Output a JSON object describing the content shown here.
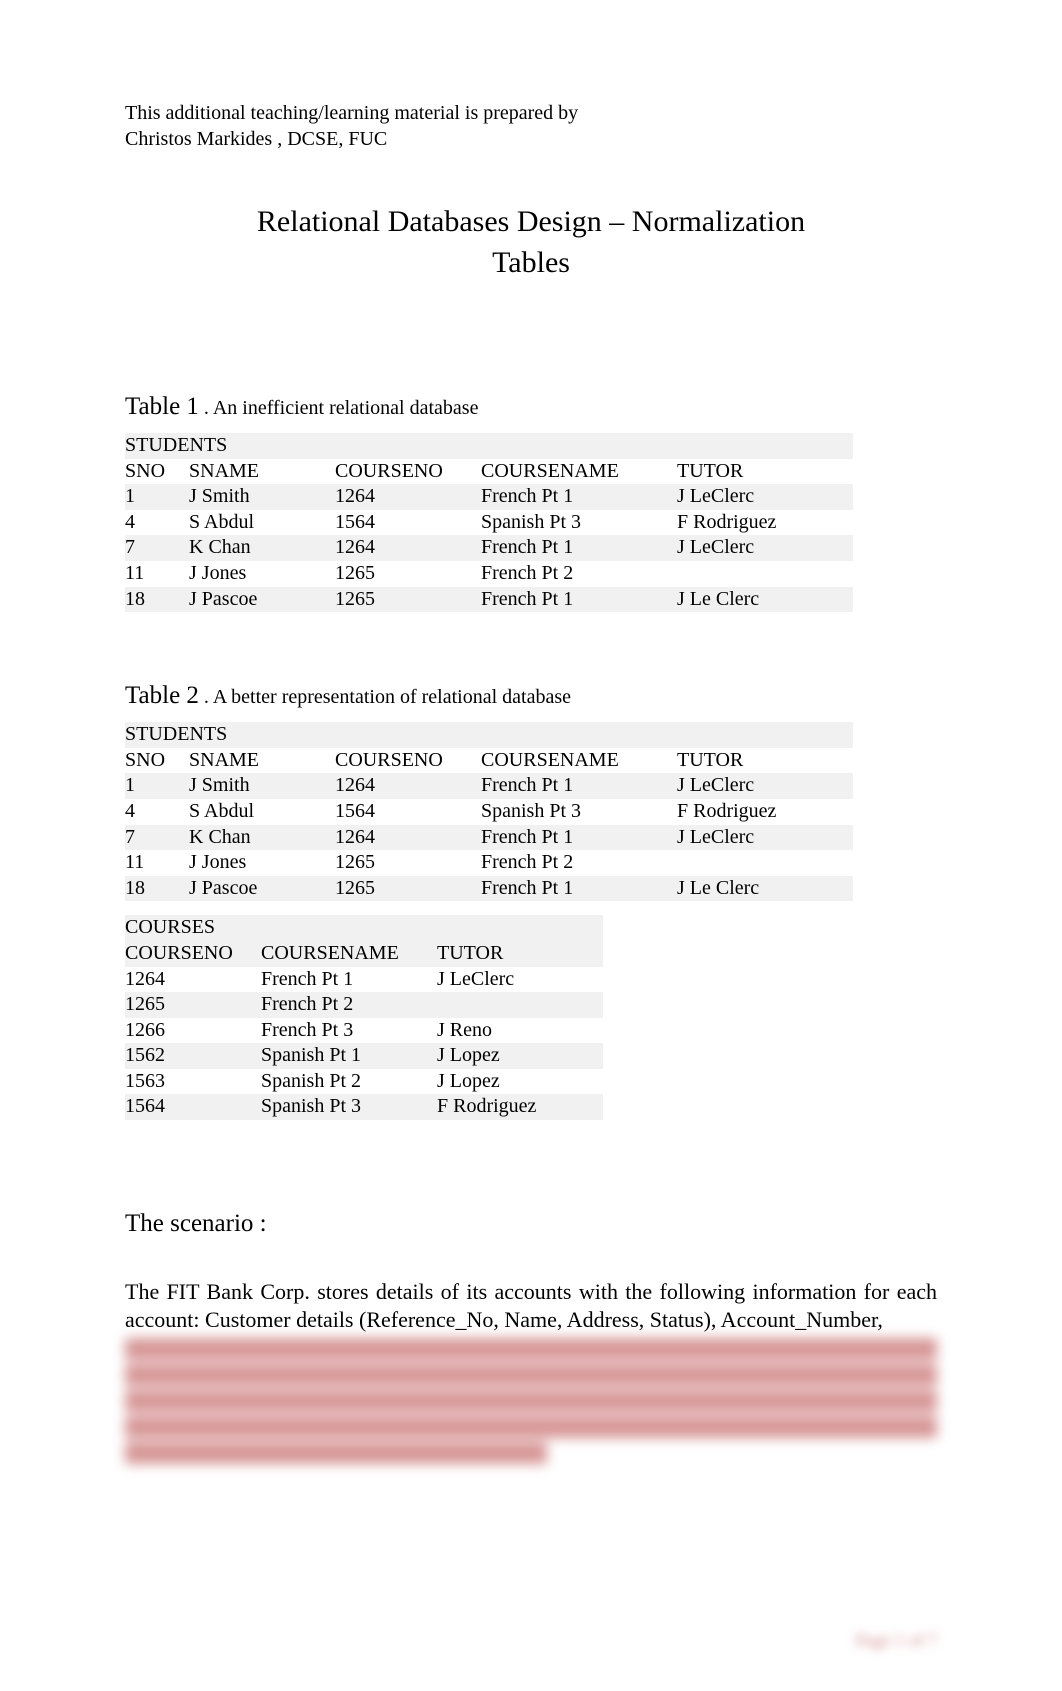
{
  "prep": {
    "line1": "This additional teaching/learning material is prepared by",
    "line2": "Christos Markides   , DCSE, FUC"
  },
  "title": {
    "line1": "Relational Databases Design – Normalization",
    "line2": "Tables"
  },
  "table1": {
    "label": "Table 1",
    "dot": " . ",
    "caption": "An inefficient relational database",
    "title": "STUDENTS",
    "headers": [
      "SNO",
      "SNAME",
      "COURSENO",
      "COURSENAME",
      "TUTOR"
    ],
    "rows": [
      [
        "1",
        "J Smith",
        "1264",
        "French Pt 1",
        "J LeClerc"
      ],
      [
        "4",
        "S Abdul",
        "1564",
        "Spanish Pt 3",
        "F Rodriguez"
      ],
      [
        "7",
        "K Chan",
        "1264",
        "French Pt 1",
        "J LeClerc"
      ],
      [
        "11",
        "J Jones",
        "1265",
        "French Pt 2",
        ""
      ],
      [
        "18",
        "J Pascoe",
        "1265",
        "French Pt 1",
        "J Le Clerc"
      ]
    ]
  },
  "table2": {
    "label": "Table 2",
    "dot": " . ",
    "caption": "A better representation of relational database",
    "studentsTitle": "STUDENTS",
    "headers": [
      "SNO",
      "SNAME",
      "COURSENO",
      "COURSENAME",
      "TUTOR"
    ],
    "rows": [
      [
        "1",
        "J Smith",
        "1264",
        "French Pt 1",
        "J LeClerc"
      ],
      [
        "4",
        "S Abdul",
        "1564",
        "Spanish Pt 3",
        "F Rodriguez"
      ],
      [
        "7",
        "K Chan",
        "1264",
        "French Pt 1",
        "J LeClerc"
      ],
      [
        "11",
        "J Jones",
        "1265",
        "French Pt 2",
        ""
      ],
      [
        "18",
        "J Pascoe",
        "1265",
        "French Pt 1",
        "J Le Clerc"
      ]
    ],
    "coursesTitle": "COURSES",
    "coursesHeaders": [
      "COURSENO",
      "COURSENAME",
      "TUTOR"
    ],
    "coursesRows": [
      [
        "1264",
        "French Pt 1",
        "J LeClerc"
      ],
      [
        "1265",
        "French Pt 2",
        ""
      ],
      [
        "1266",
        "French Pt 3",
        "J Reno"
      ],
      [
        "1562",
        "Spanish Pt 1",
        "J Lopez"
      ],
      [
        "1563",
        "Spanish Pt 2",
        "J Lopez"
      ],
      [
        "1564",
        "Spanish Pt 3",
        "F Rodriguez"
      ]
    ]
  },
  "scenario": {
    "heading": "The scenario  :",
    "body": "The FIT Bank Corp. stores details of its accounts with the following information for each account: Customer details (Reference_No, Name, Address, Status), Account_Number,"
  },
  "pagenum": "Page 1 of 7"
}
